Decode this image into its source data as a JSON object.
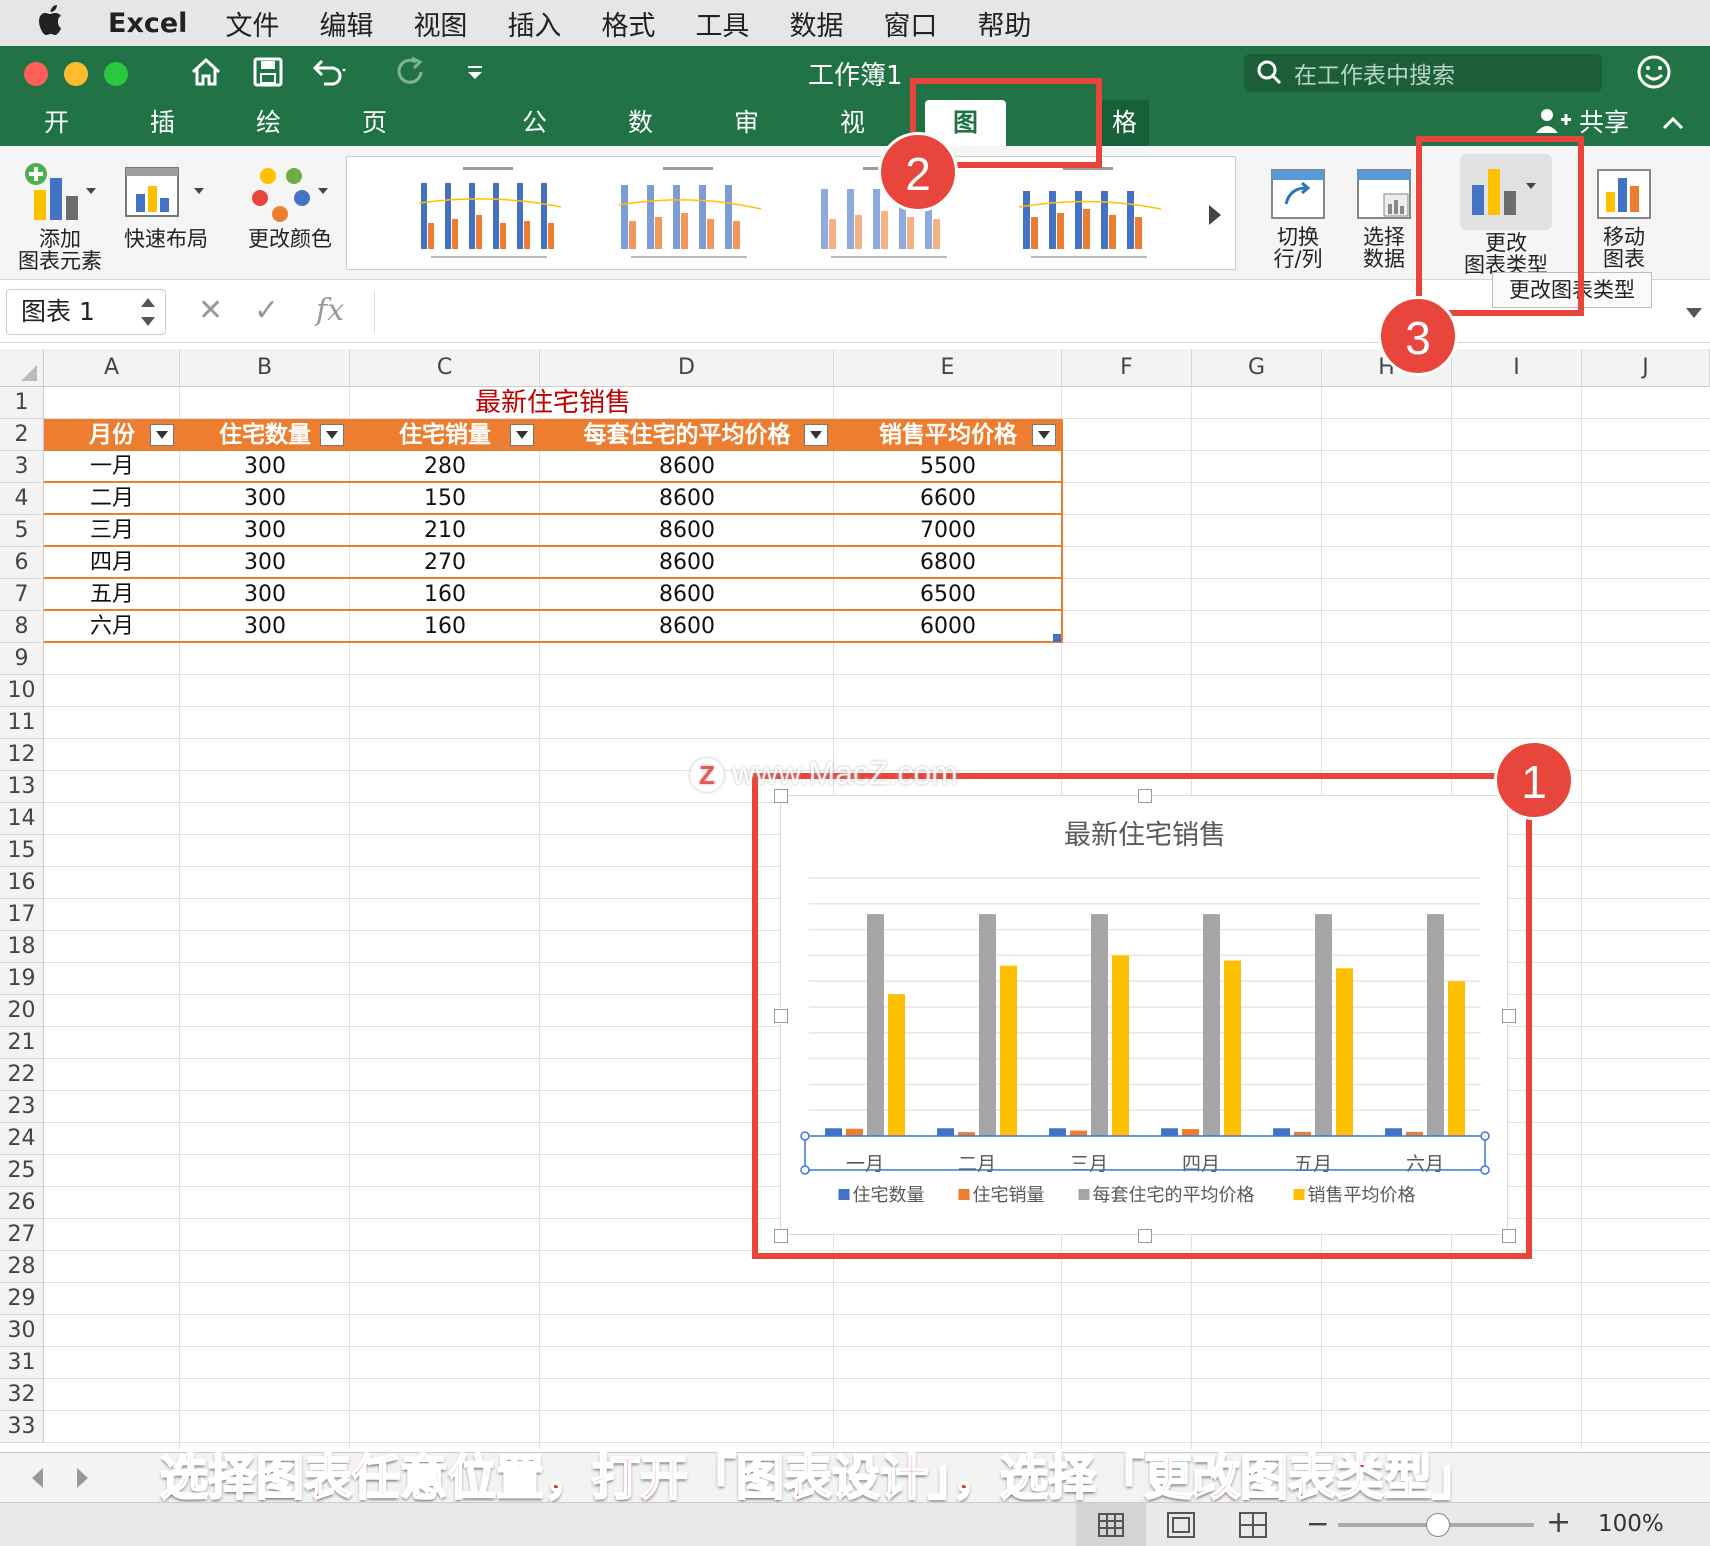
{
  "menubar": {
    "app": "Excel",
    "items": [
      "文件",
      "编辑",
      "视图",
      "插入",
      "格式",
      "工具",
      "数据",
      "窗口",
      "帮助"
    ]
  },
  "window": {
    "title": "工作簿1",
    "search_placeholder": "在工作表中搜索",
    "share_label": "共享"
  },
  "ribbon_tabs": [
    "开始",
    "插入",
    "绘图",
    "页面布局",
    "公式",
    "数据",
    "审阅",
    "视图",
    "图表设计",
    "格式"
  ],
  "ribbon": {
    "add_element_line1": "添加",
    "add_element_line2": "图表元素",
    "quick_layout": "快速布局",
    "change_colors": "更改颜色",
    "switch_line1": "切换",
    "switch_line2": "行/列",
    "select_line1": "选择",
    "select_line2": "数据",
    "change_type_line1": "更改",
    "change_type_line2": "图表类型",
    "move_line1": "移动",
    "move_line2": "图表",
    "tooltip": "更改图表类型"
  },
  "formula_bar": {
    "name_box": "图表 1",
    "fx": "fx"
  },
  "columns": [
    "A",
    "B",
    "C",
    "D",
    "E",
    "F",
    "G",
    "H",
    "I",
    "J"
  ],
  "rows": [
    "1",
    "2",
    "3",
    "4",
    "5",
    "6",
    "7",
    "8",
    "9",
    "10",
    "11",
    "12",
    "13",
    "14",
    "15",
    "16",
    "17",
    "18",
    "19",
    "20",
    "21",
    "22",
    "23",
    "24",
    "25",
    "26",
    "27",
    "28",
    "29",
    "30",
    "31",
    "32",
    "33"
  ],
  "table": {
    "title": "最新住宅销售",
    "headers": [
      "月份",
      "住宅数量",
      "住宅销量",
      "每套住宅的平均价格",
      "销售平均价格"
    ],
    "rows": [
      [
        "一月",
        "300",
        "280",
        "8600",
        "5500"
      ],
      [
        "二月",
        "300",
        "150",
        "8600",
        "6600"
      ],
      [
        "三月",
        "300",
        "210",
        "8600",
        "7000"
      ],
      [
        "四月",
        "300",
        "270",
        "8600",
        "6800"
      ],
      [
        "五月",
        "300",
        "160",
        "8600",
        "6500"
      ],
      [
        "六月",
        "300",
        "160",
        "8600",
        "6000"
      ]
    ]
  },
  "chart_data": {
    "type": "bar",
    "title": "最新住宅销售",
    "categories": [
      "一月",
      "二月",
      "三月",
      "四月",
      "五月",
      "六月"
    ],
    "series": [
      {
        "name": "住宅数量",
        "values": [
          300,
          300,
          300,
          300,
          300,
          300
        ],
        "color": "#4472c4"
      },
      {
        "name": "住宅销量",
        "values": [
          280,
          150,
          210,
          270,
          160,
          160
        ],
        "color": "#ed7d31"
      },
      {
        "name": "每套住宅的平均价格",
        "values": [
          8600,
          8600,
          8600,
          8600,
          8600,
          8600
        ],
        "color": "#a5a5a5"
      },
      {
        "name": "销售平均价格",
        "values": [
          5500,
          6600,
          7000,
          6800,
          6500,
          6000
        ],
        "color": "#ffc000"
      }
    ],
    "ylim": [
      0,
      10000
    ],
    "grid": true,
    "legend": "bottom"
  },
  "annotations": {
    "badge1": "1",
    "badge2": "2",
    "badge3": "3",
    "watermark": "www.MacZ.com",
    "caption": "选择图表任意位置，打开「图表设计」，选择「更改图表类型」"
  },
  "status": {
    "zoom": "100%"
  },
  "colors": {
    "excel_green": "#217346",
    "accent_red": "#e8453c",
    "table_orange": "#ed7d31"
  }
}
